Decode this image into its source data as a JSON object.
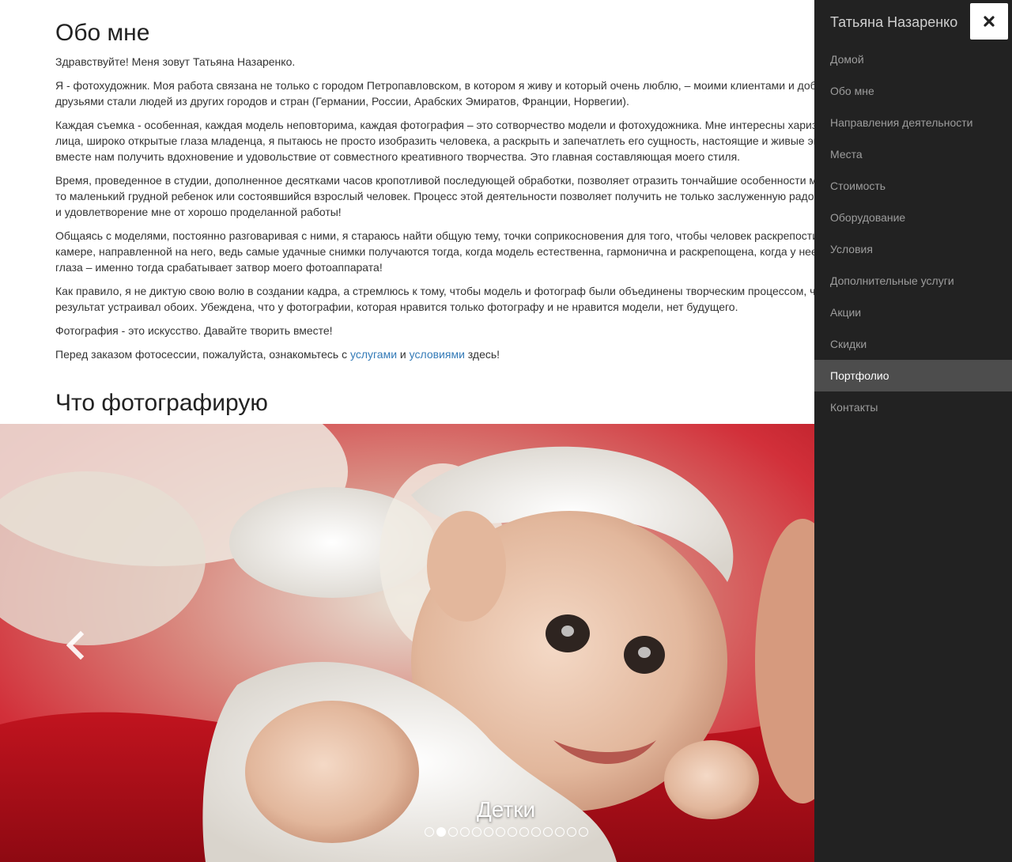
{
  "about": {
    "title": "Обо мне",
    "paragraphs": [
      "Здравствуйте! Меня зовут Татьяна Назаренко.",
      "Я - фотохудожник. Моя работа связана не только с городом Петропавловском, в котором я живу и который очень люблю, – моими клиентами и добрыми друзьями стали людей из других городов и стран (Германии, России, Арабских Эмиратов, Франции, Норвегии).",
      "Каждая съемка - особенная, каждая модель неповторима, каждая фотография – это сотворчество модели и фотохудожника. Мне интересны харизматичные лица, широко открытые глаза младенца, я пытаюсь не просто изобразить человека, а раскрыть и запечатлеть его сущность, настоящие и живые эмоции, помочь вместе нам получить вдохновение и удовольствие от совместного креативного творчества. Это главная составляющая моего стиля.",
      "Время, проведенное в студии, дополненное десятками часов кропотливой последующей обработки, позволяет отразить тончайшие особенности модели – будь то маленький грудной ребенок или состоявшийся взрослый человек. Процесс этой деятельности позволяет получить не только заслуженную радость клиенту, но и удовлетворение мне от хорошо проделанной работы!",
      "Общаясь с моделями, постоянно разговаривая с ними, я стараюсь найти общую тему, точки соприкосновения для того, чтобы человек раскрепостился и забыл о камере, направленной на него, ведь самые удачные снимки получаются тогда, когда модель естественна, гармонична и раскрепощена, когда у нее светятся глаза – именно тогда срабатывает затвор моего фотоаппарата!",
      "Как правило, я не диктую свою волю в создании кадра, а стремлюсь к тому, чтобы модель и фотограф были объединены творческим процессом, что бы результат устраивал обоих. Убеждена, что у фотографии, которая нравится только фотографу и не нравится модели, нет будущего.",
      "Фотография - это искусство. Давайте творить вместе!"
    ],
    "order_prefix": "Перед заказом фотосессии, пожалуйста, ознакомьтесь с ",
    "services_link": "услугами",
    "order_and": " и ",
    "conditions_link": "условиями",
    "order_suffix": " здесь!"
  },
  "what_title": "Что фотографирую",
  "carousel": {
    "caption": "Детки",
    "slide_count": 14,
    "active_index": 1,
    "prev_icon": "chevron-left-icon"
  },
  "sidebar": {
    "title": "Татьяна Назаренко",
    "close_icon": "close-icon",
    "items": [
      {
        "label": "Домой",
        "slug": "home"
      },
      {
        "label": "Обо мне",
        "slug": "about"
      },
      {
        "label": "Направления деятельности",
        "slug": "directions"
      },
      {
        "label": "Места",
        "slug": "places"
      },
      {
        "label": "Стоимость",
        "slug": "price"
      },
      {
        "label": "Оборудование",
        "slug": "equipment"
      },
      {
        "label": "Условия",
        "slug": "conditions"
      },
      {
        "label": "Дополнительные услуги",
        "slug": "extra-services"
      },
      {
        "label": "Акции",
        "slug": "promotions"
      },
      {
        "label": "Скидки",
        "slug": "discounts"
      },
      {
        "label": "Портфолио",
        "slug": "portfolio",
        "active": true
      },
      {
        "label": "Контакты",
        "slug": "contacts"
      }
    ]
  },
  "colors": {
    "link": "#337ab7",
    "sidebar_bg": "#222222",
    "sidebar_active_bg": "#4d4d4d",
    "sidebar_text": "#9d9d9d"
  }
}
